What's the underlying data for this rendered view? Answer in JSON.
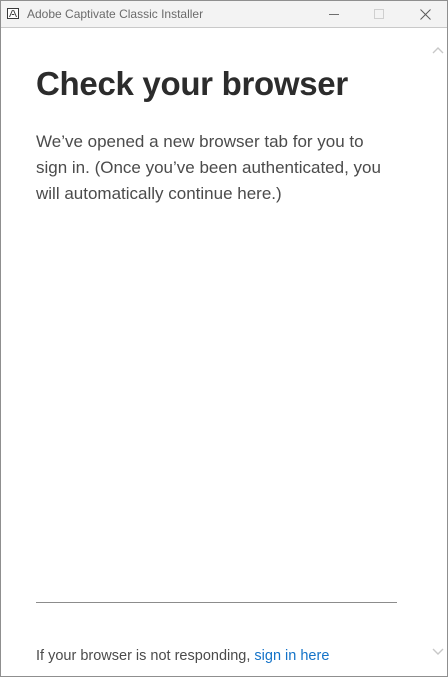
{
  "window": {
    "title": "Adobe Captivate Classic Installer",
    "app_icon": "adobe-logo-icon",
    "controls": {
      "minimize": "minimize-icon",
      "maximize": "maximize-icon",
      "close": "close-icon"
    }
  },
  "main": {
    "heading": "Check your browser",
    "body": "We’ve opened a new browser tab for you to sign in. (Once you’ve been authenticated, you will automatically continue here.)"
  },
  "footer": {
    "prompt": "If your browser is not responding, ",
    "link_label": "sign in here"
  },
  "colors": {
    "link": "#1473c8",
    "heading": "#2c2c2c",
    "body_text": "#4b4b4b"
  }
}
